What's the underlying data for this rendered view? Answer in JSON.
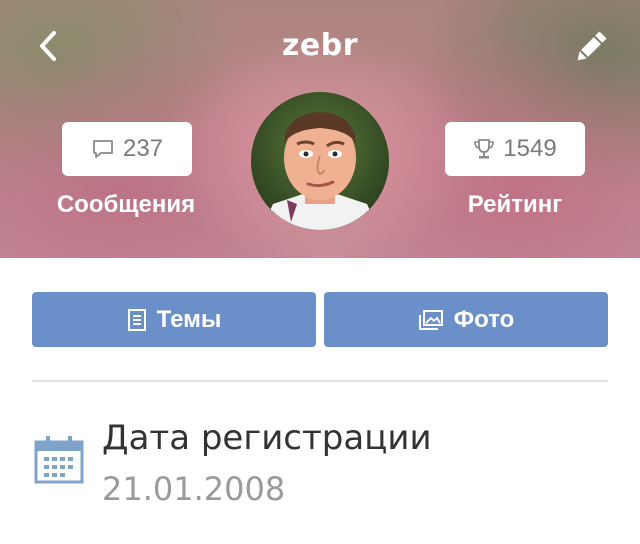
{
  "header": {
    "title": "zebr",
    "back_icon": "chevron-left-icon",
    "edit_icon": "pencil-icon"
  },
  "stats": {
    "messages": {
      "count": "237",
      "label": "Сообщения",
      "icon": "speech-bubble-icon"
    },
    "rating": {
      "count": "1549",
      "label": "Рейтинг",
      "icon": "trophy-icon"
    }
  },
  "avatar": {
    "icon": "user-photo"
  },
  "actions": {
    "topics_label": "Темы",
    "photos_label": "Фото",
    "accent": "#6a8fc9"
  },
  "info": {
    "registration_title": "Дата регистрации",
    "registration_value": "21.01.2008",
    "icon": "calendar-icon"
  }
}
